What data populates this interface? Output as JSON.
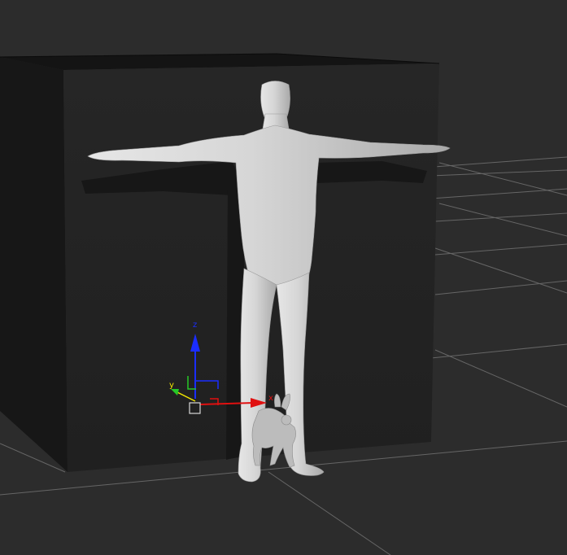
{
  "viewport": {
    "background_color": "#2c2c2c",
    "grid_color": "#6a6a6a",
    "box_color": "#1c1c1c",
    "figure_color": "#cfcfcf",
    "bunny_color": "#bdbdbd"
  },
  "gizmo": {
    "axes": [
      {
        "label": "z",
        "color": "#1a2dff",
        "icon": "arrow-up"
      },
      {
        "label": "y",
        "color": "#f2e600",
        "icon": "arrow-diagonal"
      },
      {
        "label": "x",
        "color": "#e01010",
        "icon": "arrow-right"
      }
    ],
    "center_icon": "square-handle"
  }
}
